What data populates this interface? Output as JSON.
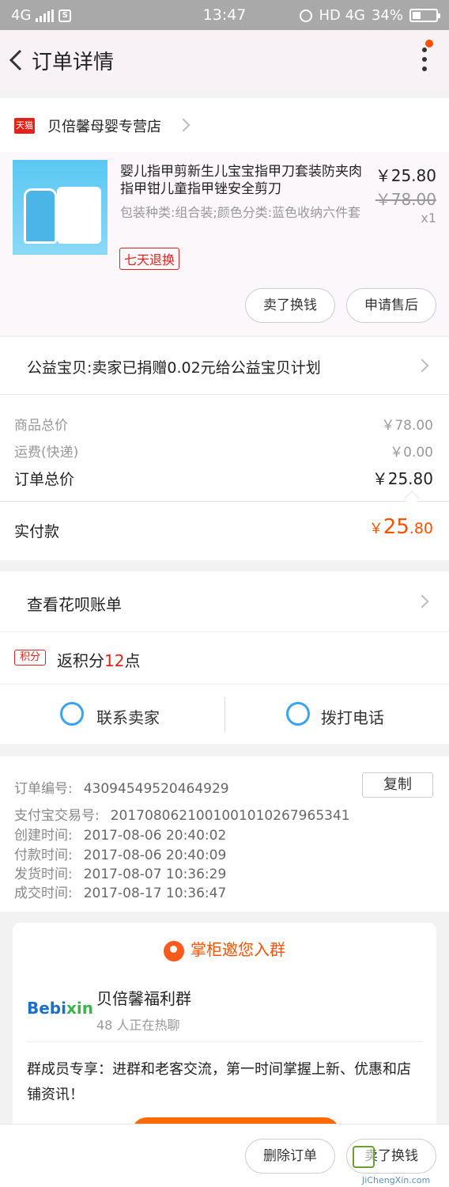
{
  "status_bar": {
    "network_left": "4G",
    "time": "13:47",
    "network_right": "HD 4G",
    "battery": "34%",
    "battery_level": 0.34
  },
  "nav": {
    "title": "订单详情"
  },
  "shop": {
    "badge": "天猫",
    "name": "贝倍馨母婴专营店"
  },
  "item": {
    "title": "婴儿指甲剪新生儿宝宝指甲刀套装防夹肉指甲钳儿童指甲锉安全剪刀",
    "spec": "包装种类:组合装;颜色分类:蓝色收纳六件套",
    "tag": "七天退换",
    "price_now": "￥25.80",
    "price_old": "￥78.00",
    "qty": "x1",
    "btn_sell": "卖了换钱",
    "btn_after_sale": "申请售后"
  },
  "charity": {
    "text": "公益宝贝:卖家已捐赠0.02元给公益宝贝计划"
  },
  "summary": {
    "goods_label": "商品总价",
    "goods_value": "￥78.00",
    "ship_label": "运费(快递)",
    "ship_value": "￥0.00",
    "order_label": "订单总价",
    "order_value": "￥25.80",
    "paid_label": "实付款",
    "paid_currency": "￥",
    "paid_int": "25",
    "paid_dec": ".80"
  },
  "huabei": {
    "text": "查看花呗账单"
  },
  "points": {
    "badge": "积分",
    "prefix": "返积分",
    "num": "12",
    "suffix": "点"
  },
  "contact": {
    "seller": "联系卖家",
    "phone": "拨打电话"
  },
  "info": {
    "order_no_label": "订单编号:",
    "order_no": "43094549520464929",
    "copy": "复制",
    "alipay_label": "支付宝交易号:",
    "alipay_no": "2017080621001001010267965341",
    "created_label": "创建时间:",
    "created": "2017-08-06 20:40:02",
    "paid_label": "付款时间:",
    "paid": "2017-08-06 20:40:09",
    "shipped_label": "发货时间:",
    "shipped": "2017-08-07 10:36:29",
    "done_label": "成交时间:",
    "done": "2017-08-17 10:36:47"
  },
  "group": {
    "header": "掌柜邀您入群",
    "logo_a": "Bebi",
    "logo_b": "xin",
    "name": "贝倍馨福利群",
    "count": "48 人正在热聊",
    "desc": "群成员专享：进群和老客交流，第一时间掌握上新、优惠和店铺资讯！"
  },
  "bottom": {
    "delete": "删除订单",
    "sell": "卖了换钱"
  },
  "watermark": {
    "text": "JiChengXin.com"
  },
  "colors": {
    "accent": "#ff5000",
    "tmall_red": "#e2231a",
    "link_blue": "#3aa2f0"
  }
}
